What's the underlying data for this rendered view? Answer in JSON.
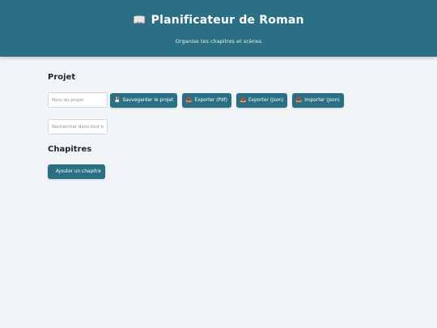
{
  "header": {
    "icon": "📖",
    "title": "Planificateur de Roman",
    "subtitle": "Organise tes chapitres et scènes"
  },
  "project": {
    "section_title": "Projet",
    "name_placeholder": "Nom du projet",
    "save_label": "Sauvegarder le projet",
    "export_pdf_label": "Exporter (Pdf)",
    "export_json_label": "Exporter (json)",
    "import_json_label": "Importer (json)",
    "separator": "·",
    "icons": {
      "save": "💾",
      "export_pdf": "📥",
      "export_json": "📤",
      "import_json": "📥"
    }
  },
  "search": {
    "placeholder": "Rechercher dans tout le projet"
  },
  "chapters": {
    "section_title": "Chapitres",
    "add_label": "Ajouter un chapitre"
  },
  "colors": {
    "brand": "#2b6f85",
    "background": "#f1f5f7"
  }
}
